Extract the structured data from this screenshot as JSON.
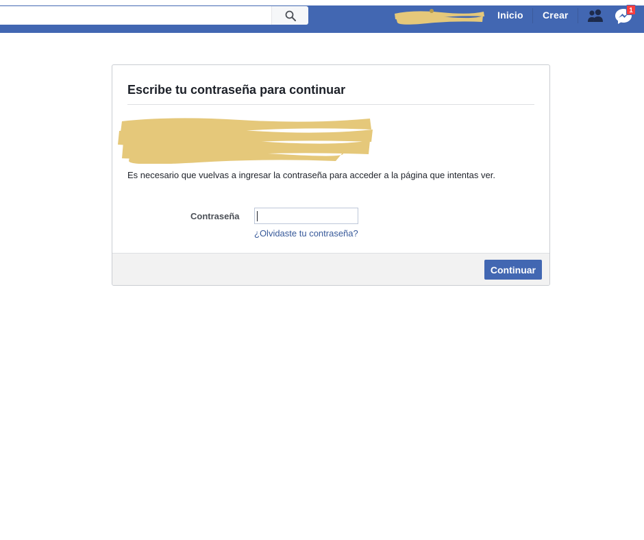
{
  "topbar": {
    "search_placeholder": "",
    "nav": {
      "home_label": "Inicio",
      "create_label": "Crear"
    },
    "messenger_badge": "1",
    "icons": [
      "search-icon",
      "friends-icon",
      "messenger-icon"
    ]
  },
  "dialog": {
    "title": "Escribe tu contraseña para continuar",
    "description": "Es necesario que vuelvas a ingresar la contraseña para acceder a la página que intentas ver.",
    "password_label": "Contraseña",
    "password_value": "",
    "forgot_link": "¿Olvidaste tu contraseña?",
    "continue_label": "Continuar"
  },
  "colors": {
    "brand": "#4267b2",
    "link": "#365899",
    "badge": "#fa3e3e",
    "redaction": "#e5c87a"
  }
}
